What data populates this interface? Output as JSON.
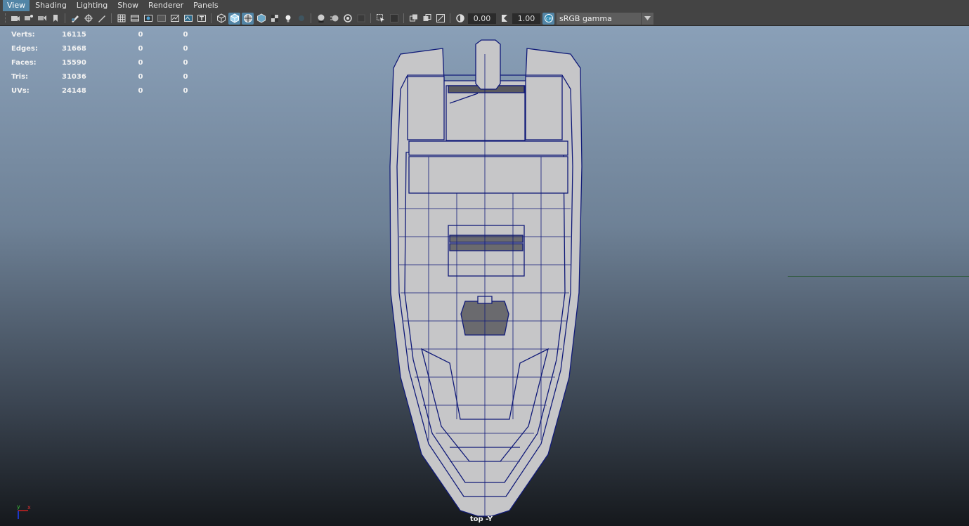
{
  "menu": {
    "items": [
      {
        "label": "View",
        "active": true
      },
      {
        "label": "Shading",
        "active": false
      },
      {
        "label": "Lighting",
        "active": false
      },
      {
        "label": "Show",
        "active": false
      },
      {
        "label": "Renderer",
        "active": false
      },
      {
        "label": "Panels",
        "active": false
      }
    ]
  },
  "toolbar": {
    "exposure_value": "0.00",
    "gamma_value": "1.00",
    "color_space": "sRGB gamma",
    "icons": [
      "camera-select-icon",
      "camera-attributes-icon",
      "camera-bookmarks-icon",
      "image-plane-icon",
      "grease-pencil-icon",
      "grid-icon",
      "film-gate-icon",
      "resolution-gate-icon",
      "gate-mask-icon",
      "field-chart-icon",
      "safe-action-icon",
      "safe-title-icon",
      "wireframe-icon",
      "smooth-shade-icon",
      "wireframe-on-shaded-icon",
      "default-material-icon",
      "xray-icon",
      "textured-icon",
      "lights-icon",
      "shadows-icon",
      "screen-space-ao-icon",
      "motion-blur-icon",
      "anti-aliasing-icon",
      "depth-of-field-icon",
      "isolate-select-icon",
      "xray-joints-icon",
      "xray-active-icon",
      "backface-culling-icon",
      "exposure-icon",
      "gamma-icon",
      "color-management-icon"
    ]
  },
  "hud": {
    "rows": [
      {
        "label": "Verts:",
        "v1": "16115",
        "v2": "0",
        "v3": "0"
      },
      {
        "label": "Edges:",
        "v1": "31668",
        "v2": "0",
        "v3": "0"
      },
      {
        "label": "Faces:",
        "v1": "15590",
        "v2": "0",
        "v3": "0"
      },
      {
        "label": "Tris:",
        "v1": "31036",
        "v2": "0",
        "v3": "0"
      },
      {
        "label": "UVs:",
        "v1": "24148",
        "v2": "0",
        "v3": "0"
      }
    ]
  },
  "viewport": {
    "camera_label": "top -Y",
    "axis_x": "x",
    "axis_y": "y",
    "colors": {
      "wire": "#0f1a7a",
      "surface": "#c7c7c9",
      "active_tool": "#5285a6",
      "ground_line": "#2f5a3c"
    }
  }
}
